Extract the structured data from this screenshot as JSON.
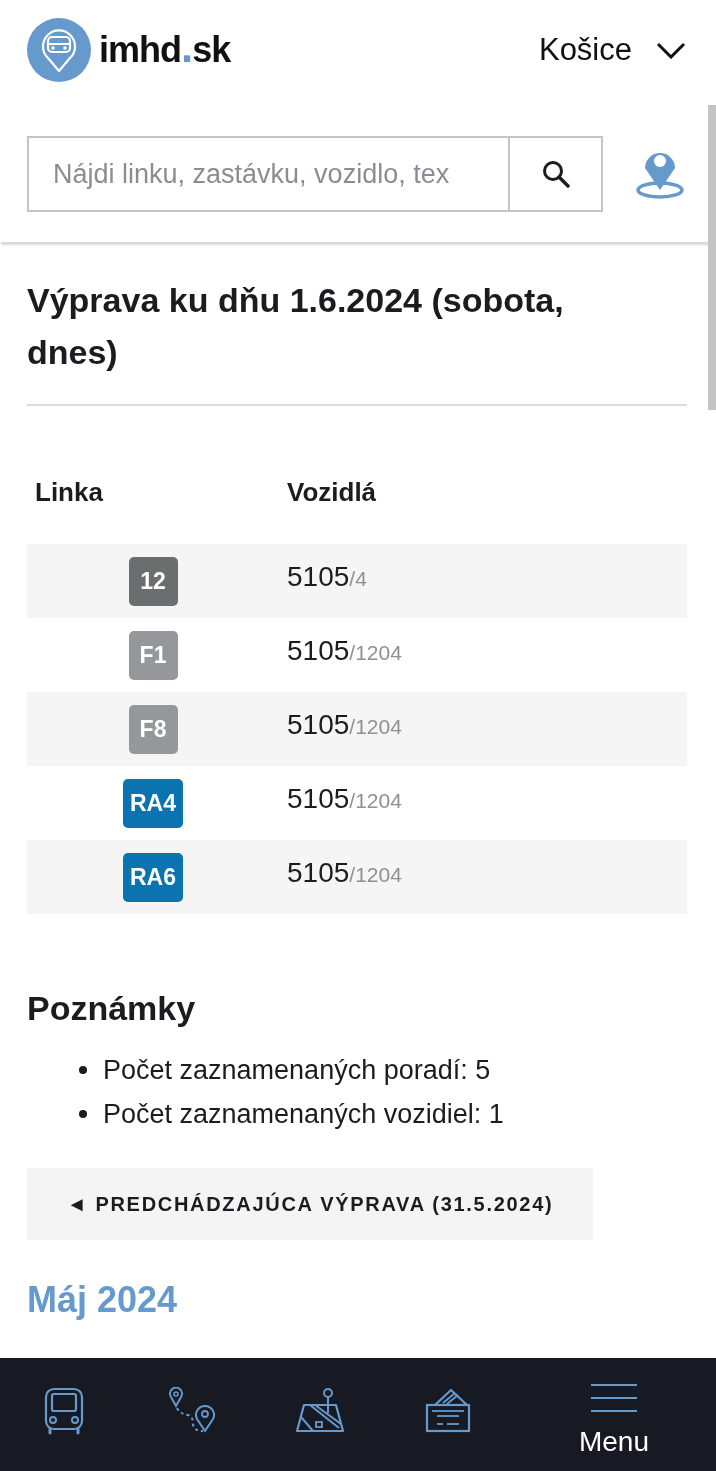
{
  "header": {
    "logo": {
      "name": "imhd",
      "separator": ".",
      "domain": "sk"
    },
    "city": "Košice"
  },
  "search": {
    "placeholder": "Nájdi linku, zastávku, vozidlo, tex"
  },
  "title": "Výprava ku dňu 1.6.2024 (sobota, dnes)",
  "table": {
    "columns": [
      "Linka",
      "Vozidlá"
    ],
    "rows": [
      {
        "line": "12",
        "color": "#6b6e6f",
        "vehicle": "5105",
        "run": "/4"
      },
      {
        "line": "F1",
        "color": "#96979b",
        "vehicle": "5105",
        "run": "/1204"
      },
      {
        "line": "F8",
        "color": "#96979b",
        "vehicle": "5105",
        "run": "/1204"
      },
      {
        "line": "RA4",
        "color": "#0a73b0",
        "vehicle": "5105",
        "run": "/1204"
      },
      {
        "line": "RA6",
        "color": "#0a73b0",
        "vehicle": "5105",
        "run": "/1204"
      }
    ]
  },
  "notes": {
    "title": "Poznámky",
    "items": [
      "Počet zaznamenaných poradí: 5",
      "Počet zaznamenaných vozidiel: 1"
    ]
  },
  "previous_button": {
    "label": "◄ PREDCHÁDZAJÚCA VÝPRAVA (31.5.2024)"
  },
  "calendar": {
    "month": "Máj 2024"
  },
  "bottom_nav": {
    "items": [
      {
        "kind": "bus"
      },
      {
        "kind": "route"
      },
      {
        "kind": "map"
      },
      {
        "kind": "ticket"
      },
      {
        "kind": "menu",
        "label": "Menu"
      }
    ]
  }
}
